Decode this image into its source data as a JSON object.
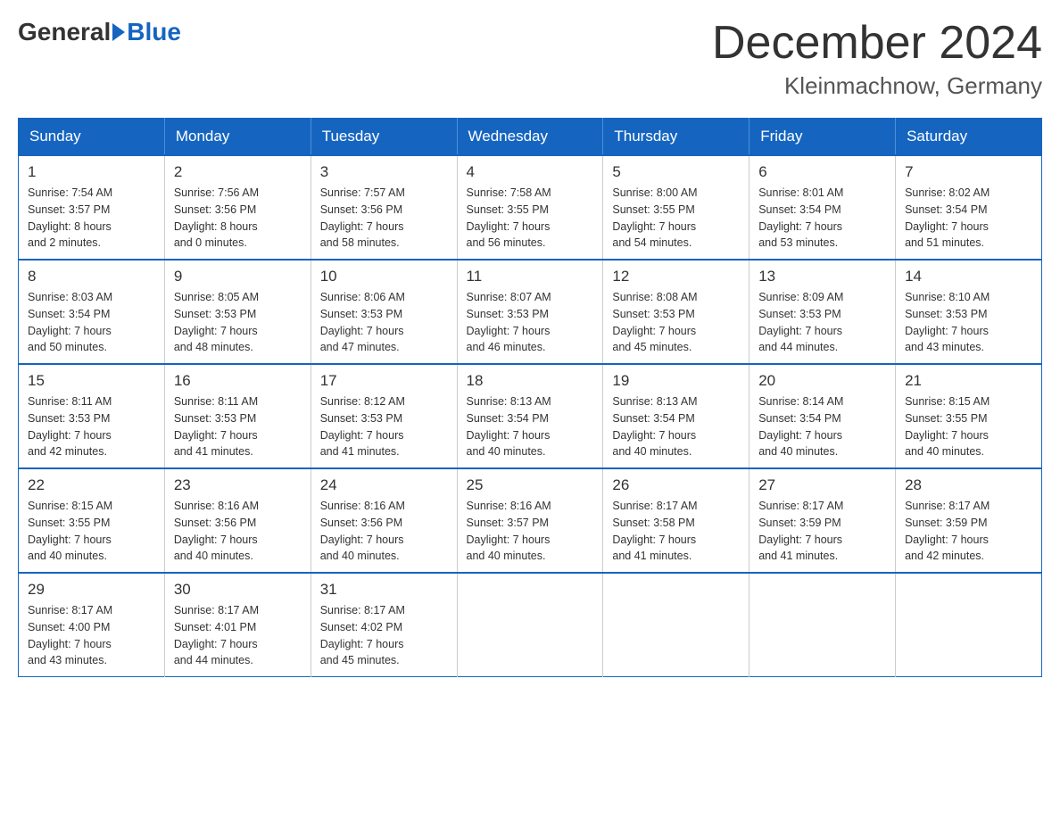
{
  "logo": {
    "general": "General",
    "blue": "Blue"
  },
  "header": {
    "month_year": "December 2024",
    "location": "Kleinmachnow, Germany"
  },
  "days_of_week": [
    "Sunday",
    "Monday",
    "Tuesday",
    "Wednesday",
    "Thursday",
    "Friday",
    "Saturday"
  ],
  "weeks": [
    [
      {
        "day": "1",
        "sunrise": "7:54 AM",
        "sunset": "3:57 PM",
        "daylight": "8 hours and 2 minutes."
      },
      {
        "day": "2",
        "sunrise": "7:56 AM",
        "sunset": "3:56 PM",
        "daylight": "8 hours and 0 minutes."
      },
      {
        "day": "3",
        "sunrise": "7:57 AM",
        "sunset": "3:56 PM",
        "daylight": "7 hours and 58 minutes."
      },
      {
        "day": "4",
        "sunrise": "7:58 AM",
        "sunset": "3:55 PM",
        "daylight": "7 hours and 56 minutes."
      },
      {
        "day": "5",
        "sunrise": "8:00 AM",
        "sunset": "3:55 PM",
        "daylight": "7 hours and 54 minutes."
      },
      {
        "day": "6",
        "sunrise": "8:01 AM",
        "sunset": "3:54 PM",
        "daylight": "7 hours and 53 minutes."
      },
      {
        "day": "7",
        "sunrise": "8:02 AM",
        "sunset": "3:54 PM",
        "daylight": "7 hours and 51 minutes."
      }
    ],
    [
      {
        "day": "8",
        "sunrise": "8:03 AM",
        "sunset": "3:54 PM",
        "daylight": "7 hours and 50 minutes."
      },
      {
        "day": "9",
        "sunrise": "8:05 AM",
        "sunset": "3:53 PM",
        "daylight": "7 hours and 48 minutes."
      },
      {
        "day": "10",
        "sunrise": "8:06 AM",
        "sunset": "3:53 PM",
        "daylight": "7 hours and 47 minutes."
      },
      {
        "day": "11",
        "sunrise": "8:07 AM",
        "sunset": "3:53 PM",
        "daylight": "7 hours and 46 minutes."
      },
      {
        "day": "12",
        "sunrise": "8:08 AM",
        "sunset": "3:53 PM",
        "daylight": "7 hours and 45 minutes."
      },
      {
        "day": "13",
        "sunrise": "8:09 AM",
        "sunset": "3:53 PM",
        "daylight": "7 hours and 44 minutes."
      },
      {
        "day": "14",
        "sunrise": "8:10 AM",
        "sunset": "3:53 PM",
        "daylight": "7 hours and 43 minutes."
      }
    ],
    [
      {
        "day": "15",
        "sunrise": "8:11 AM",
        "sunset": "3:53 PM",
        "daylight": "7 hours and 42 minutes."
      },
      {
        "day": "16",
        "sunrise": "8:11 AM",
        "sunset": "3:53 PM",
        "daylight": "7 hours and 41 minutes."
      },
      {
        "day": "17",
        "sunrise": "8:12 AM",
        "sunset": "3:53 PM",
        "daylight": "7 hours and 41 minutes."
      },
      {
        "day": "18",
        "sunrise": "8:13 AM",
        "sunset": "3:54 PM",
        "daylight": "7 hours and 40 minutes."
      },
      {
        "day": "19",
        "sunrise": "8:13 AM",
        "sunset": "3:54 PM",
        "daylight": "7 hours and 40 minutes."
      },
      {
        "day": "20",
        "sunrise": "8:14 AM",
        "sunset": "3:54 PM",
        "daylight": "7 hours and 40 minutes."
      },
      {
        "day": "21",
        "sunrise": "8:15 AM",
        "sunset": "3:55 PM",
        "daylight": "7 hours and 40 minutes."
      }
    ],
    [
      {
        "day": "22",
        "sunrise": "8:15 AM",
        "sunset": "3:55 PM",
        "daylight": "7 hours and 40 minutes."
      },
      {
        "day": "23",
        "sunrise": "8:16 AM",
        "sunset": "3:56 PM",
        "daylight": "7 hours and 40 minutes."
      },
      {
        "day": "24",
        "sunrise": "8:16 AM",
        "sunset": "3:56 PM",
        "daylight": "7 hours and 40 minutes."
      },
      {
        "day": "25",
        "sunrise": "8:16 AM",
        "sunset": "3:57 PM",
        "daylight": "7 hours and 40 minutes."
      },
      {
        "day": "26",
        "sunrise": "8:17 AM",
        "sunset": "3:58 PM",
        "daylight": "7 hours and 41 minutes."
      },
      {
        "day": "27",
        "sunrise": "8:17 AM",
        "sunset": "3:59 PM",
        "daylight": "7 hours and 41 minutes."
      },
      {
        "day": "28",
        "sunrise": "8:17 AM",
        "sunset": "3:59 PM",
        "daylight": "7 hours and 42 minutes."
      }
    ],
    [
      {
        "day": "29",
        "sunrise": "8:17 AM",
        "sunset": "4:00 PM",
        "daylight": "7 hours and 43 minutes."
      },
      {
        "day": "30",
        "sunrise": "8:17 AM",
        "sunset": "4:01 PM",
        "daylight": "7 hours and 44 minutes."
      },
      {
        "day": "31",
        "sunrise": "8:17 AM",
        "sunset": "4:02 PM",
        "daylight": "7 hours and 45 minutes."
      },
      null,
      null,
      null,
      null
    ]
  ],
  "labels": {
    "sunrise": "Sunrise:",
    "sunset": "Sunset:",
    "daylight": "Daylight:"
  }
}
